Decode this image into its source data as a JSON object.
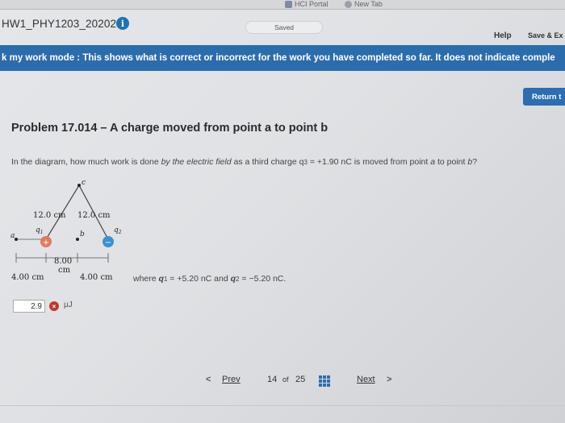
{
  "browser": {
    "tab_portal": "HCI Portal",
    "tab_new": "New Tab"
  },
  "header": {
    "assignment_title": "HW1_PHY1203_202020",
    "saved_status": "Saved",
    "help_label": "Help",
    "save_exit_label": "Save & Ex"
  },
  "banner": {
    "text": "k my work mode : This shows what is correct or incorrect for the work you have completed so far. It does not indicate comple"
  },
  "return_button": "Return t",
  "problem": {
    "title": "Problem 17.014 – A charge moved from point a to point b",
    "question_prefix": "In the diagram, how much work is done ",
    "question_italic": "by the electric field",
    "question_mid": " as a third charge q",
    "question_sub": "3",
    "question_value": " = +1.90 nC is moved from point ",
    "point_a": "a",
    "question_to": " to point ",
    "point_b": "b",
    "question_end": "?"
  },
  "diagram": {
    "label_c": "c",
    "label_a": "a",
    "label_b": "b",
    "label_q1": "q",
    "label_q1_sub": "1",
    "label_q2": "q",
    "label_q2_sub": "2",
    "side_left": "12.0 cm",
    "side_right": "12.0 cm",
    "mid_distance_1": "8.00",
    "mid_distance_2": "cm",
    "left_distance": "4.00 cm",
    "right_distance": "4.00 cm",
    "plus_sign": "+",
    "minus_sign": "−"
  },
  "where": {
    "prefix": "where ",
    "q1": "q",
    "q1_sub": "1",
    "q1_val": " = +5.20 nC and ",
    "q2": "q",
    "q2_sub": "2",
    "q2_val": " = −5.20 nC."
  },
  "answer": {
    "value": "2.9",
    "mark": "×",
    "unit": "µJ"
  },
  "pager": {
    "prev": "Prev",
    "prev_chevron": "<",
    "current": "14",
    "of": "of",
    "total": "25",
    "next": "Next",
    "next_chevron": ">"
  },
  "colors": {
    "banner_bg": "#2b6cad",
    "info_icon": "#1a73b8",
    "charge_positive": "#e07a5f",
    "charge_negative": "#3f8fd0",
    "wrong_mark": "#c0392b"
  },
  "icons": [
    "info-icon",
    "wrong-answer-icon",
    "question-map-grid-icon"
  ]
}
